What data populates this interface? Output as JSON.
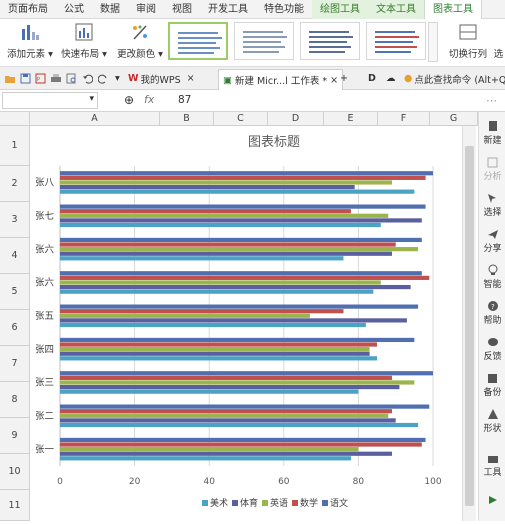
{
  "menu": [
    "页面布局",
    "公式",
    "数据",
    "审阅",
    "视图",
    "开发工具",
    "特色功能",
    "绘图工具",
    "文本工具",
    "图表工具"
  ],
  "ribbon": {
    "add_element": "添加元素",
    "quick_layout": "快速布局",
    "change_color": "更改颜色",
    "switch_rowcol": "切换行列",
    "select_data": "选"
  },
  "tabbar": {
    "my_wps": "我的WPS",
    "doc_tab": "新建 Micr...l 工作表 *",
    "search_cmd": "点此查找命令 (Alt+Q"
  },
  "formula": {
    "fx": "fx",
    "value": "87"
  },
  "columns": [
    "A",
    "B",
    "C",
    "D",
    "E",
    "F",
    "G"
  ],
  "rows": [
    "1",
    "2",
    "3",
    "4",
    "5",
    "6",
    "7",
    "8",
    "9",
    "10",
    "11"
  ],
  "right_panel": [
    "新建",
    "分析",
    "选择",
    "分享",
    "智能",
    "帮助",
    "反馈",
    "备份",
    "形状",
    "工具"
  ],
  "colors": {
    "series1": "#4aa3c4",
    "series2": "#595f9f",
    "series3": "#9cb44e",
    "series4": "#c0504d",
    "series5": "#4f6fb0"
  },
  "chart_data": {
    "type": "bar",
    "orientation": "horizontal",
    "title": "图表标题",
    "categories": [
      "张一",
      "张二",
      "张三",
      "张四",
      "张五",
      "张六",
      "张六",
      "张七",
      "张八"
    ],
    "series": [
      {
        "name": "美术",
        "values": [
          78,
          96,
          80,
          85,
          82,
          84,
          76,
          86,
          95
        ]
      },
      {
        "name": "体育",
        "values": [
          89,
          90,
          91,
          83,
          93,
          94,
          89,
          97,
          79
        ]
      },
      {
        "name": "英语",
        "values": [
          80,
          88,
          95,
          83,
          67,
          86,
          96,
          88,
          89
        ]
      },
      {
        "name": "数学",
        "values": [
          97,
          89,
          89,
          85,
          76,
          99,
          90,
          78,
          98
        ]
      },
      {
        "name": "语文",
        "values": [
          98,
          99,
          100,
          95,
          96,
          97,
          97,
          98,
          100
        ]
      }
    ],
    "xlim": [
      0,
      100
    ],
    "xticks": [
      0,
      20,
      40,
      60,
      80,
      100
    ],
    "grid": true,
    "legend": "bottom"
  }
}
